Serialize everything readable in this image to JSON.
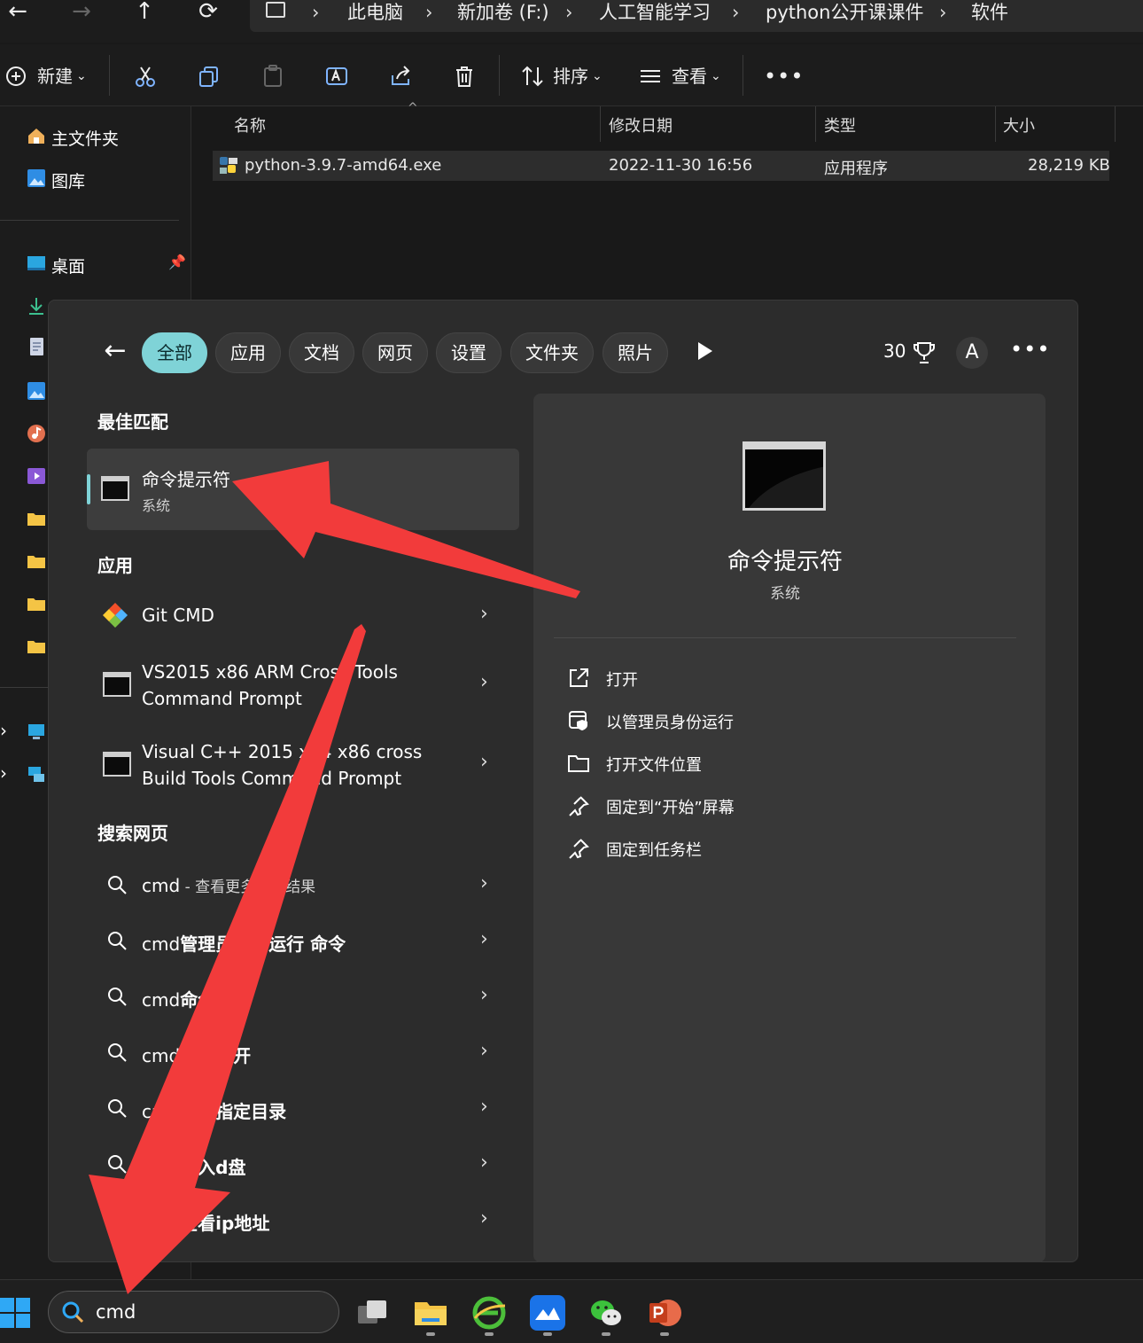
{
  "breadcrumb": {
    "items": [
      "此电脑",
      "新加卷 (F:)",
      "人工智能学习",
      "python公开课课件",
      "软件"
    ]
  },
  "toolbar": {
    "new_label": "新建",
    "sort_label": "排序",
    "view_label": "查看"
  },
  "sidebar": {
    "home_label": "主文件夹",
    "gallery_label": "图库",
    "desktop_label": "桌面"
  },
  "file_list": {
    "columns": [
      "名称",
      "修改日期",
      "类型",
      "大小"
    ],
    "rows": [
      {
        "name": "python-3.9.7-amd64.exe",
        "modified": "2022-11-30 16:56",
        "type": "应用程序",
        "size": "28,219 KB"
      }
    ]
  },
  "search_panel": {
    "filters": [
      "全部",
      "应用",
      "文档",
      "网页",
      "设置",
      "文件夹",
      "照片"
    ],
    "points": "30",
    "avatar_letter": "A",
    "best_match_heading": "最佳匹配",
    "best_match": {
      "title": "命令提示符",
      "subtitle": "系统"
    },
    "apps_heading": "应用",
    "apps": [
      {
        "line1": "Git CMD",
        "line2": ""
      },
      {
        "line1": "VS2015 x86 ARM Cross Tools",
        "line2": "Command Prompt"
      },
      {
        "line1": "Visual C++ 2015 x64 x86 cross",
        "line2": "Build Tools Command Prompt"
      }
    ],
    "web_heading": "搜索网页",
    "web": [
      {
        "prefix": "cmd",
        "bold": "",
        "muted": " - 查看更多搜索结果"
      },
      {
        "prefix": "cmd",
        "bold": "管理员身份运行 命令",
        "muted": ""
      },
      {
        "prefix": "cmd",
        "bold": "命令大全",
        "muted": ""
      },
      {
        "prefix": "cmd",
        "bold": "怎么打开",
        "muted": ""
      },
      {
        "prefix": "cmd",
        "bold": "进入指定目录",
        "muted": ""
      },
      {
        "prefix": "cmd",
        "bold": "进入d盘",
        "muted": ""
      },
      {
        "prefix": "cmd",
        "bold": "查看ip地址",
        "muted": ""
      }
    ],
    "detail": {
      "title": "命令提示符",
      "subtitle": "系统",
      "actions": [
        "打开",
        "以管理员身份运行",
        "打开文件位置",
        "固定到“开始”屏幕",
        "固定到任务栏"
      ]
    }
  },
  "taskbar": {
    "search_value": "cmd"
  },
  "colors": {
    "accent": "#7fd3d7",
    "annotation_arrow": "#f23b3b"
  }
}
